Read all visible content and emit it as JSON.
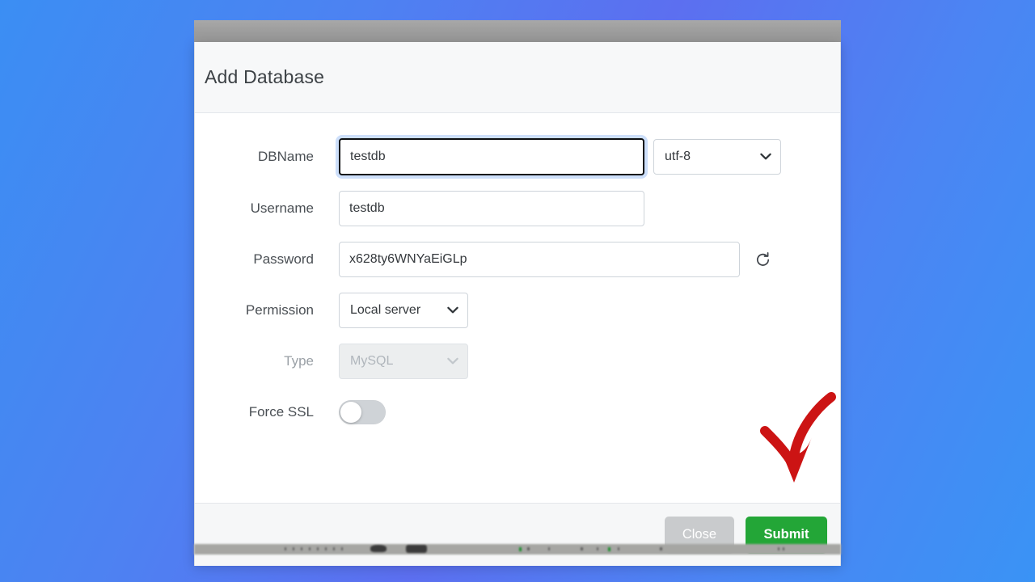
{
  "dialog": {
    "title": "Add Database",
    "fields": [
      {
        "label": "DBName",
        "type": "text",
        "value": "testdb",
        "placeholder": "",
        "focused": true,
        "addon": {
          "kind": "select",
          "value": "utf-8"
        }
      },
      {
        "label": "Username",
        "type": "text",
        "value": "testdb",
        "placeholder": "",
        "focused": false
      },
      {
        "label": "Password",
        "type": "text",
        "value": "x628ty6WNYaEiGLp",
        "placeholder": "",
        "focused": false,
        "addon": {
          "kind": "icon",
          "icon": "refresh-icon"
        }
      },
      {
        "label": "Permission",
        "type": "select",
        "value": "Local server",
        "disabled": false
      },
      {
        "label": "Type",
        "type": "select",
        "value": "MySQL",
        "disabled": true
      },
      {
        "label": "Force SSL",
        "type": "toggle",
        "value": "off"
      }
    ],
    "footer": {
      "close_label": "Close",
      "submit_label": "Submit"
    }
  },
  "annotation": {
    "kind": "curved-down-arrow",
    "color": "#cc1414",
    "points_at": "Submit"
  },
  "colors": {
    "submit_green": "#23a637",
    "close_gray": "#c9cbcd",
    "focus_ring": "#87b2f4",
    "backdrop_blue_left": "#3b8ef3",
    "backdrop_blue_mid": "#5c6ff0"
  }
}
